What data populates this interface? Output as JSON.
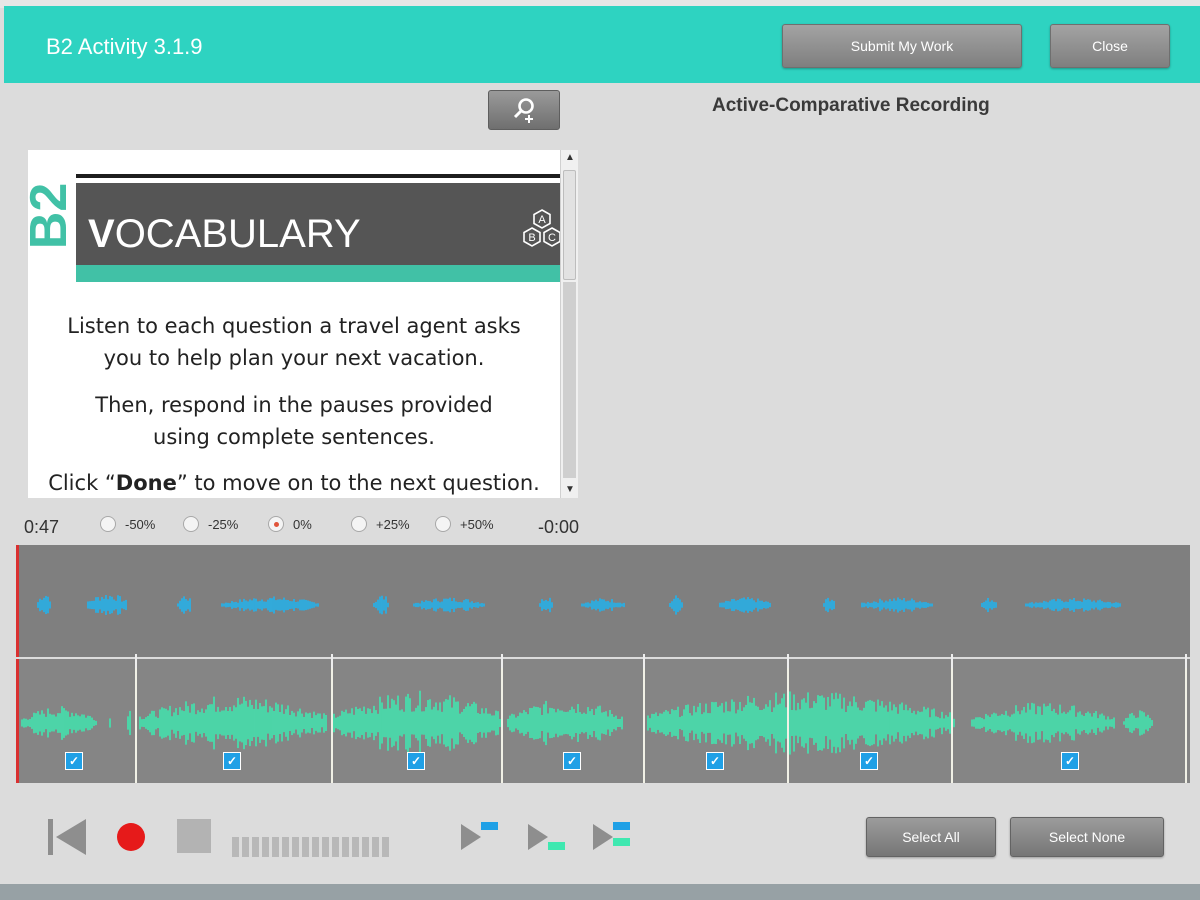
{
  "header": {
    "title": "B2 Activity 3.1.9",
    "submit_label": "Submit My Work",
    "close_label": "Close",
    "bg_color": "#2ed3c1"
  },
  "toolbar": {
    "zoom_icon": "zoom-magnifier-icon"
  },
  "recording": {
    "title": "Active-Comparative Recording"
  },
  "content": {
    "level": "B2",
    "banner_first_letter": "V",
    "banner_rest": "OCABULARY",
    "para1_line1": "Listen to each question a travel agent asks",
    "para1_line2": "you to help plan your next vacation.",
    "para2_line1": "Then, respond in the pauses provided",
    "para2_line2": "using complete sentences.",
    "para3_prefix": "Click “",
    "para3_bold": "Done",
    "para3_suffix": "” to move on to the next question.",
    "hex_letters": [
      "A",
      "B",
      "C"
    ]
  },
  "player": {
    "time_elapsed": "0:47",
    "time_remaining": "-0:00",
    "speeds": [
      {
        "label": "-50%",
        "selected": false
      },
      {
        "label": "-25%",
        "selected": false
      },
      {
        "label": "0%",
        "selected": true
      },
      {
        "label": "+25%",
        "selected": false
      },
      {
        "label": "+50%",
        "selected": false
      }
    ],
    "segment_count": 7,
    "segments_checked": [
      true,
      true,
      true,
      true,
      true,
      true,
      true
    ],
    "source_wave_color": "#1fb4f0",
    "student_wave_color": "#3fe8b0"
  },
  "transport": {
    "icons": [
      "skip-to-start-icon",
      "record-icon",
      "stop-icon",
      "play-source-icon",
      "play-student-icon",
      "play-both-icon"
    ],
    "select_all_label": "Select All",
    "select_none_label": "Select None"
  }
}
